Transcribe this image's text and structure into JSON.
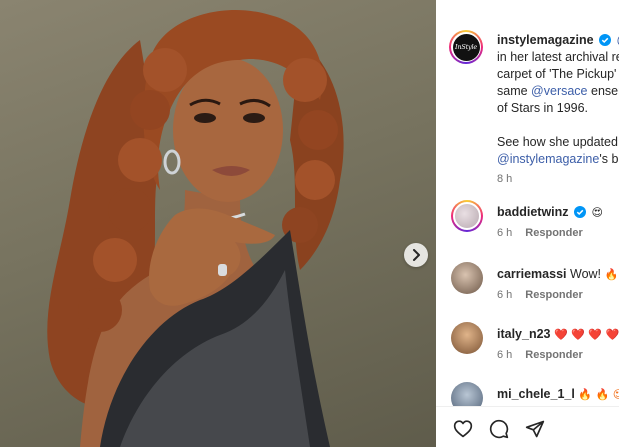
{
  "post": {
    "author": "instylemagazine",
    "avatar_text": "InStyle",
    "caption_lines": [
      {
        "pre": "",
        "link": "@",
        "post": ""
      },
      {
        "pre": "in her latest archival re",
        "link": "",
        "post": ""
      },
      {
        "pre": "carpet of 'The Pickup'",
        "link": "",
        "post": ""
      },
      {
        "pre": "same ",
        "link": "@versace",
        "post": " ensem"
      },
      {
        "pre": "of Stars in 1996.",
        "link": "",
        "post": ""
      },
      {
        "pre": "",
        "link": "",
        "post": ""
      },
      {
        "pre": "See how she updated",
        "link": "",
        "post": ""
      },
      {
        "pre": "",
        "link": "@instylemagazine",
        "post": "'s bi"
      }
    ],
    "time": "8 h"
  },
  "comments": [
    {
      "user": "baddietwinz",
      "verified": true,
      "text": "",
      "emoji": "😍",
      "time": "6 h",
      "reply": "Responder"
    },
    {
      "user": "carriemassi",
      "verified": false,
      "text": "Wow!",
      "emoji": "🔥",
      "time": "6 h",
      "reply": "Responder"
    },
    {
      "user": "italy_n23",
      "verified": false,
      "text": "",
      "emoji": "❤️ ❤️ ❤️ ❤️",
      "time": "6 h",
      "reply": "Responder"
    },
    {
      "user": "mi_chele_1_l",
      "verified": false,
      "text": "",
      "emoji": "🔥 🔥 😍",
      "time": "",
      "reply": ""
    }
  ],
  "icons": {
    "next": "chevron-right-icon",
    "like": "heart-icon",
    "comment": "comment-bubble-icon",
    "share": "paper-plane-icon",
    "verified": "verified-badge-icon"
  },
  "colors": {
    "link": "#3c5ea8",
    "verified": "#0095f6",
    "meta": "#737373",
    "hair": "#9a4a22"
  }
}
